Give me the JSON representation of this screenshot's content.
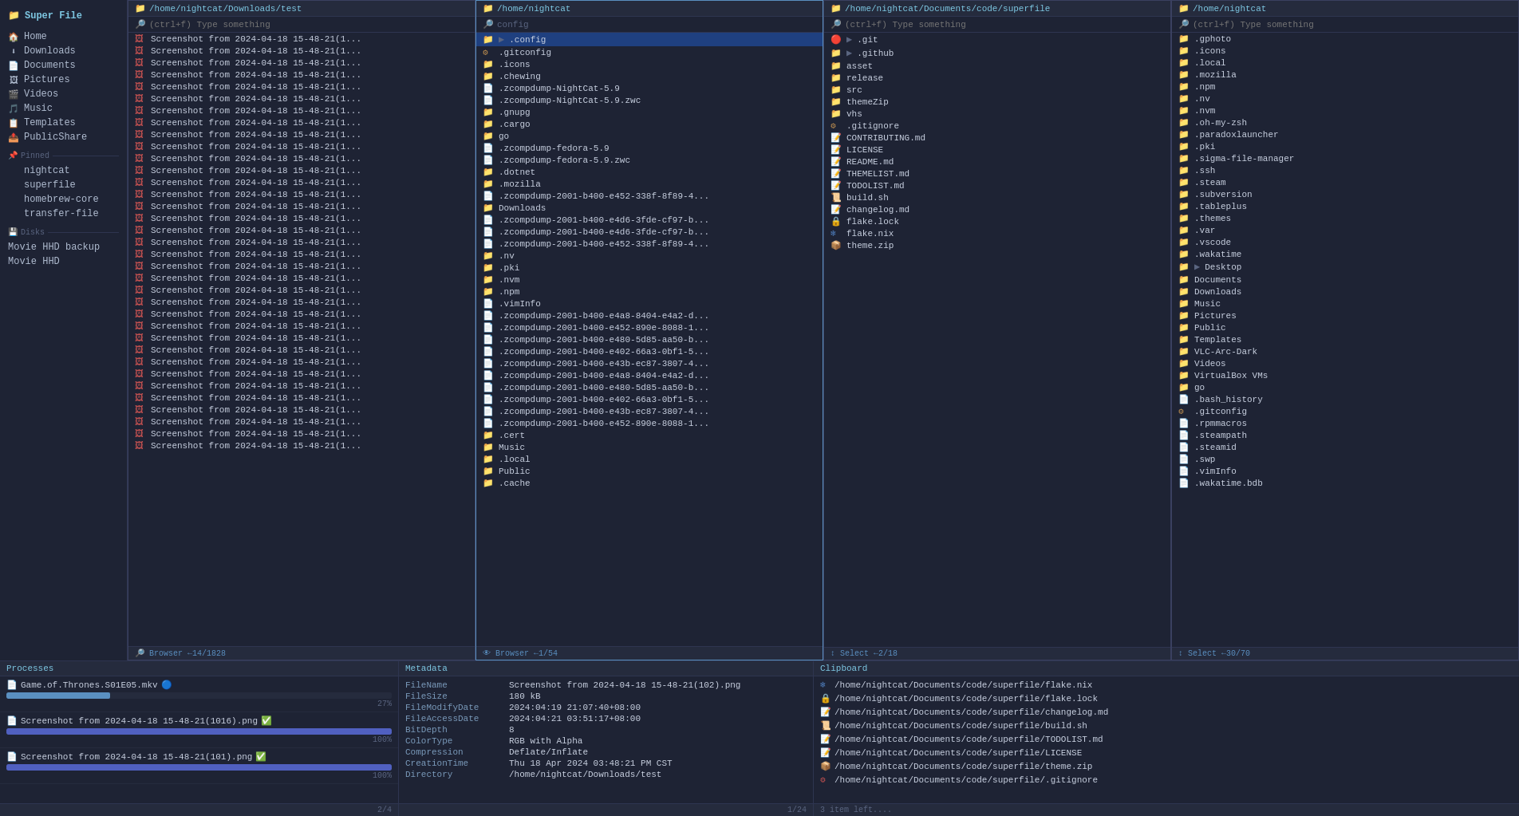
{
  "app": {
    "title": "Super File"
  },
  "sidebar": {
    "home_items": [
      {
        "label": "Home",
        "icon": "🏠"
      },
      {
        "label": "Downloads",
        "icon": "⬇"
      },
      {
        "label": "Documents",
        "icon": "📄"
      },
      {
        "label": "Pictures",
        "icon": "🖼"
      },
      {
        "label": "Videos",
        "icon": "🎬"
      },
      {
        "label": "Music",
        "icon": "🎵"
      },
      {
        "label": "Templates",
        "icon": "📋"
      },
      {
        "label": "PublicShare",
        "icon": "📤"
      }
    ],
    "pinned_label": "Pinned",
    "pinned_items": [
      {
        "label": "nightcat"
      },
      {
        "label": "superfile"
      },
      {
        "label": "homebrew-core"
      },
      {
        "label": "transfer-file"
      }
    ],
    "disks_label": "Disks",
    "disk_items": [
      {
        "label": "Movie HHD backup"
      },
      {
        "label": "Movie HHD"
      }
    ]
  },
  "panels": [
    {
      "id": "panel1",
      "path": "/home/nightcat/Downloads/test",
      "search_placeholder": "(ctrl+f) Type something",
      "active": false,
      "files": [
        {
          "name": "Screenshot from 2024-04-18 15-48-21(1...",
          "type": "image"
        },
        {
          "name": "Screenshot from 2024-04-18 15-48-21(1...",
          "type": "image"
        },
        {
          "name": "Screenshot from 2024-04-18 15-48-21(1...",
          "type": "image"
        },
        {
          "name": "Screenshot from 2024-04-18 15-48-21(1...",
          "type": "image"
        },
        {
          "name": "Screenshot from 2024-04-18 15-48-21(1...",
          "type": "image"
        },
        {
          "name": "Screenshot from 2024-04-18 15-48-21(1...",
          "type": "image"
        },
        {
          "name": "Screenshot from 2024-04-18 15-48-21(1...",
          "type": "image"
        },
        {
          "name": "Screenshot from 2024-04-18 15-48-21(1...",
          "type": "image"
        },
        {
          "name": "Screenshot from 2024-04-18 15-48-21(1...",
          "type": "image"
        },
        {
          "name": "Screenshot from 2024-04-18 15-48-21(1...",
          "type": "image"
        },
        {
          "name": "Screenshot from 2024-04-18 15-48-21(1...",
          "type": "image"
        },
        {
          "name": "Screenshot from 2024-04-18 15-48-21(1...",
          "type": "image"
        },
        {
          "name": "Screenshot from 2024-04-18 15-48-21(1...",
          "type": "image"
        },
        {
          "name": "Screenshot from 2024-04-18 15-48-21(1...",
          "type": "image"
        },
        {
          "name": "Screenshot from 2024-04-18 15-48-21(1...",
          "type": "image"
        },
        {
          "name": "Screenshot from 2024-04-18 15-48-21(1...",
          "type": "image"
        },
        {
          "name": "Screenshot from 2024-04-18 15-48-21(1...",
          "type": "image"
        },
        {
          "name": "Screenshot from 2024-04-18 15-48-21(1...",
          "type": "image"
        },
        {
          "name": "Screenshot from 2024-04-18 15-48-21(1...",
          "type": "image"
        },
        {
          "name": "Screenshot from 2024-04-18 15-48-21(1...",
          "type": "image"
        },
        {
          "name": "Screenshot from 2024-04-18 15-48-21(1...",
          "type": "image"
        },
        {
          "name": "Screenshot from 2024-04-18 15-48-21(1...",
          "type": "image"
        },
        {
          "name": "Screenshot from 2024-04-18 15-48-21(1...",
          "type": "image"
        },
        {
          "name": "Screenshot from 2024-04-18 15-48-21(1...",
          "type": "image"
        },
        {
          "name": "Screenshot from 2024-04-18 15-48-21(1...",
          "type": "image"
        },
        {
          "name": "Screenshot from 2024-04-18 15-48-21(1...",
          "type": "image"
        },
        {
          "name": "Screenshot from 2024-04-18 15-48-21(1...",
          "type": "image"
        },
        {
          "name": "Screenshot from 2024-04-18 15-48-21(1...",
          "type": "image"
        },
        {
          "name": "Screenshot from 2024-04-18 15-48-21(1...",
          "type": "image"
        },
        {
          "name": "Screenshot from 2024-04-18 15-48-21(1...",
          "type": "image"
        },
        {
          "name": "Screenshot from 2024-04-18 15-48-21(1...",
          "type": "image"
        },
        {
          "name": "Screenshot from 2024-04-18 15-48-21(1...",
          "type": "image"
        },
        {
          "name": "Screenshot from 2024-04-18 15-48-21(1...",
          "type": "image"
        },
        {
          "name": "Screenshot from 2024-04-18 15-48-21(1...",
          "type": "image"
        },
        {
          "name": "Screenshot from 2024-04-18 15-48-21(1...",
          "type": "image"
        }
      ],
      "footer": "🔎 Browser ←14/1828"
    },
    {
      "id": "panel2",
      "path": "/home/nightcat",
      "search_placeholder": "config",
      "active": true,
      "files": [
        {
          "name": ".config",
          "type": "folder",
          "expanded": true,
          "chevron": true
        },
        {
          "name": ".gitconfig",
          "type": "config"
        },
        {
          "name": ".icons",
          "type": "folder"
        },
        {
          "name": ".chewing",
          "type": "folder"
        },
        {
          "name": ".zcompdump-NightCat-5.9",
          "type": "file"
        },
        {
          "name": ".zcompdump-NightCat-5.9.zwc",
          "type": "file"
        },
        {
          "name": ".gnupg",
          "type": "folder"
        },
        {
          "name": ".cargo",
          "type": "folder"
        },
        {
          "name": "go",
          "type": "folder"
        },
        {
          "name": ".zcompdump-fedora-5.9",
          "type": "file"
        },
        {
          "name": ".zcompdump-fedora-5.9.zwc",
          "type": "file"
        },
        {
          "name": ".dotnet",
          "type": "folder"
        },
        {
          "name": ".mozilla",
          "type": "folder"
        },
        {
          "name": ".zcompdump-2001-b400-e452-338f-8f89-4...",
          "type": "file"
        },
        {
          "name": "Downloads",
          "type": "folder"
        },
        {
          "name": ".zcompdump-2001-b400-e4d6-3fde-cf97-b...",
          "type": "file"
        },
        {
          "name": ".zcompdump-2001-b400-e4d6-3fde-cf97-b...",
          "type": "file"
        },
        {
          "name": ".zcompdump-2001-b400-e452-338f-8f89-4...",
          "type": "file"
        },
        {
          "name": ".nv",
          "type": "folder"
        },
        {
          "name": ".pki",
          "type": "folder"
        },
        {
          "name": ".nvm",
          "type": "folder"
        },
        {
          "name": ".npm",
          "type": "folder"
        },
        {
          "name": ".vimInfo",
          "type": "file"
        },
        {
          "name": ".zcompdump-2001-b400-e4a8-8404-e4a2-d...",
          "type": "file"
        },
        {
          "name": ".zcompdump-2001-b400-e452-890e-8088-1...",
          "type": "file"
        },
        {
          "name": ".zcompdump-2001-b400-e480-5d85-aa50-b...",
          "type": "file"
        },
        {
          "name": ".zcompdump-2001-b400-e402-66a3-0bf1-5...",
          "type": "file"
        },
        {
          "name": ".zcompdump-2001-b400-e43b-ec87-3807-4...",
          "type": "file"
        },
        {
          "name": ".zcompdump-2001-b400-e4a8-8404-e4a2-d...",
          "type": "file"
        },
        {
          "name": ".zcompdump-2001-b400-e480-5d85-aa50-b...",
          "type": "file"
        },
        {
          "name": ".zcompdump-2001-b400-e402-66a3-0bf1-5...",
          "type": "file"
        },
        {
          "name": ".zcompdump-2001-b400-e43b-ec87-3807-4...",
          "type": "file"
        },
        {
          "name": ".zcompdump-2001-b400-e452-890e-8088-1...",
          "type": "file"
        },
        {
          "name": ".cert",
          "type": "folder"
        },
        {
          "name": "Music",
          "type": "folder"
        },
        {
          "name": ".local",
          "type": "folder"
        },
        {
          "name": "Public",
          "type": "folder"
        },
        {
          "name": ".cache",
          "type": "folder"
        }
      ],
      "footer": "👁 Browser ←1/54"
    },
    {
      "id": "panel3",
      "path": "/home/nightcat/Documents/code/superfile",
      "search_placeholder": "(ctrl+f) Type something",
      "active": false,
      "files": [
        {
          "name": ".git",
          "type": "git",
          "chevron": true
        },
        {
          "name": ".github",
          "type": "folder",
          "chevron": true
        },
        {
          "name": "asset",
          "type": "folder"
        },
        {
          "name": "release",
          "type": "folder"
        },
        {
          "name": "src",
          "type": "folder"
        },
        {
          "name": "themeZip",
          "type": "folder"
        },
        {
          "name": "vhs",
          "type": "folder"
        },
        {
          "name": ".gitignore",
          "type": "config"
        },
        {
          "name": "CONTRIBUTING.md",
          "type": "md"
        },
        {
          "name": "LICENSE",
          "type": "md"
        },
        {
          "name": "README.md",
          "type": "md"
        },
        {
          "name": "THEMELIST.md",
          "type": "md"
        },
        {
          "name": "TODOLIST.md",
          "type": "md"
        },
        {
          "name": "build.sh",
          "type": "shell"
        },
        {
          "name": "changelog.md",
          "type": "md"
        },
        {
          "name": "flake.lock",
          "type": "lock"
        },
        {
          "name": "flake.nix",
          "type": "nix"
        },
        {
          "name": "theme.zip",
          "type": "zip"
        }
      ],
      "footer": "↕ Select ←2/18"
    },
    {
      "id": "panel4",
      "path": "/home/nightcat",
      "search_placeholder": "(ctrl+f) Type something",
      "active": false,
      "files": [
        {
          "name": ".gphoto",
          "type": "folder"
        },
        {
          "name": ".icons",
          "type": "folder"
        },
        {
          "name": ".local",
          "type": "folder"
        },
        {
          "name": ".mozilla",
          "type": "folder"
        },
        {
          "name": ".npm",
          "type": "folder"
        },
        {
          "name": ".nv",
          "type": "folder"
        },
        {
          "name": ".nvm",
          "type": "folder"
        },
        {
          "name": ".oh-my-zsh",
          "type": "folder"
        },
        {
          "name": ".paradoxlauncher",
          "type": "folder"
        },
        {
          "name": ".pki",
          "type": "folder"
        },
        {
          "name": ".sigma-file-manager",
          "type": "folder"
        },
        {
          "name": ".ssh",
          "type": "folder"
        },
        {
          "name": ".steam",
          "type": "folder"
        },
        {
          "name": ".subversion",
          "type": "folder"
        },
        {
          "name": ".tableplus",
          "type": "folder"
        },
        {
          "name": ".themes",
          "type": "folder"
        },
        {
          "name": ".var",
          "type": "folder"
        },
        {
          "name": ".vscode",
          "type": "folder"
        },
        {
          "name": ".wakatime",
          "type": "folder"
        },
        {
          "name": "Desktop",
          "type": "folder",
          "chevron": true
        },
        {
          "name": "Documents",
          "type": "folder"
        },
        {
          "name": "Downloads",
          "type": "folder"
        },
        {
          "name": "Music",
          "type": "folder"
        },
        {
          "name": "Pictures",
          "type": "folder"
        },
        {
          "name": "Public",
          "type": "folder"
        },
        {
          "name": "Templates",
          "type": "folder"
        },
        {
          "name": "VLC-Arc-Dark",
          "type": "folder"
        },
        {
          "name": "Videos",
          "type": "folder"
        },
        {
          "name": "VirtualBox VMs",
          "type": "folder"
        },
        {
          "name": "go",
          "type": "folder"
        },
        {
          "name": ".bash_history",
          "type": "file"
        },
        {
          "name": ".gitconfig",
          "type": "config"
        },
        {
          "name": ".rpmmacros",
          "type": "file"
        },
        {
          "name": ".steampath",
          "type": "file"
        },
        {
          "name": ".steamid",
          "type": "file"
        },
        {
          "name": ".swp",
          "type": "file"
        },
        {
          "name": ".vimInfo",
          "type": "file"
        },
        {
          "name": ".wakatime.bdb",
          "type": "file"
        }
      ],
      "footer": "↕ Select ←30/70"
    }
  ],
  "processes": {
    "title": "Processes",
    "items": [
      {
        "name": "Game.of.Thrones.S01E05.mkv",
        "icon": "📄",
        "color_icon": "🔵",
        "progress": 27,
        "bar_color": "#5a8fc0"
      },
      {
        "name": "Screenshot from 2024-04-18 15-48-21(1016).png",
        "icon": "📄",
        "status": "✅",
        "progress": 100,
        "bar_color": "#5060c0"
      },
      {
        "name": "Screenshot from 2024-04-18 15-48-21(101).png",
        "icon": "📄",
        "status": "✅",
        "progress": 100,
        "bar_color": "#5060c0"
      }
    ],
    "counter": "2/4"
  },
  "metadata": {
    "title": "Metadata",
    "rows": [
      {
        "key": "FileName",
        "val": "Screenshot from 2024-04-18 15-48-21(102).png"
      },
      {
        "key": "FileSize",
        "val": "180 kB"
      },
      {
        "key": "FileModifyDate",
        "val": "2024:04:19 21:07:40+08:00"
      },
      {
        "key": "FileAccessDate",
        "val": "2024:04:21 03:51:17+08:00"
      },
      {
        "key": "BitDepth",
        "val": "8"
      },
      {
        "key": "ColorType",
        "val": "RGB with Alpha"
      },
      {
        "key": "Compression",
        "val": "Deflate/Inflate"
      },
      {
        "key": "CreationTime",
        "val": "Thu 18 Apr 2024 03:48:21 PM CST"
      },
      {
        "key": "Directory",
        "val": "/home/nightcat/Downloads/test"
      }
    ],
    "footer": "1/24"
  },
  "clipboard": {
    "title": "Clipboard",
    "items": [
      {
        "path": "/home/nightcat/Documents/code/superfile/flake.nix",
        "icon": "nix"
      },
      {
        "path": "/home/nightcat/Documents/code/superfile/flake.lock",
        "icon": "lock"
      },
      {
        "path": "/home/nightcat/Documents/code/superfile/changelog.md",
        "icon": "md"
      },
      {
        "path": "/home/nightcat/Documents/code/superfile/build.sh",
        "icon": "shell"
      },
      {
        "path": "/home/nightcat/Documents/code/superfile/TODOLIST.md",
        "icon": "md"
      },
      {
        "path": "/home/nightcat/Documents/code/superfile/LICENSE",
        "icon": "md"
      },
      {
        "path": "/home/nightcat/Documents/code/superfile/theme.zip",
        "icon": "zip"
      },
      {
        "path": "/home/nightcat/Documents/code/superfile/.gitignore",
        "icon": "git"
      }
    ],
    "footer": "3 item left...."
  }
}
